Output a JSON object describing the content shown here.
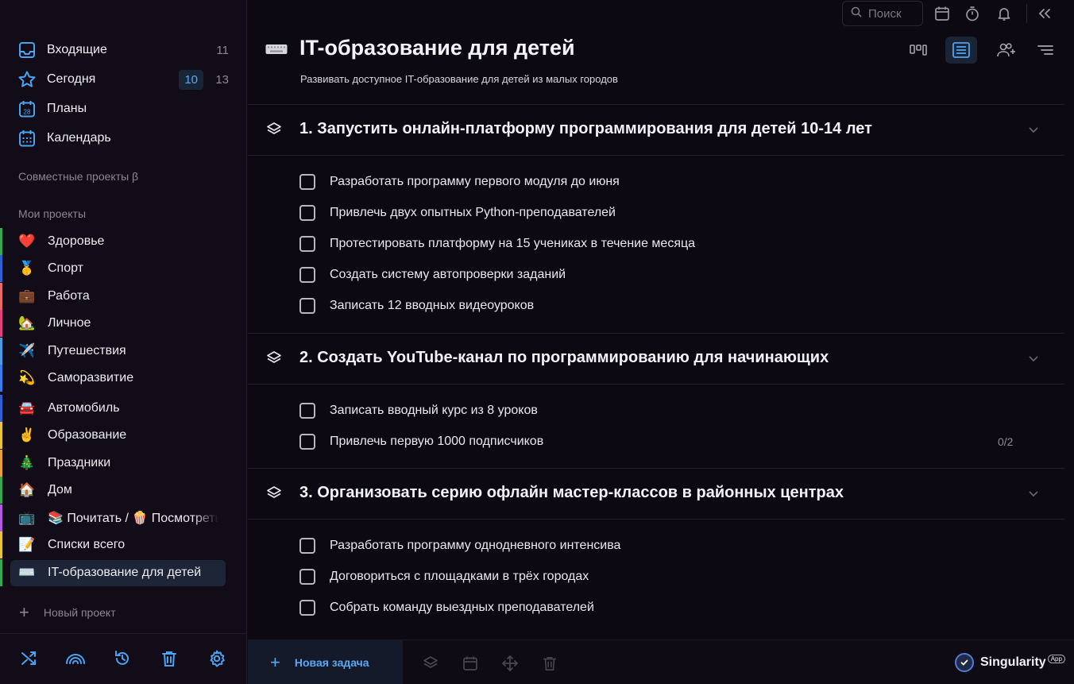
{
  "sidebar": {
    "nav": [
      {
        "label": "Входящие",
        "count": "11",
        "icon": "inbox-icon"
      },
      {
        "label": "Сегодня",
        "count_highlight": "10",
        "count": "13",
        "icon": "star-icon"
      },
      {
        "label": "Планы",
        "icon": "calendar-28-icon",
        "icon_text": "28"
      },
      {
        "label": "Календарь",
        "icon": "calendar-grid-icon"
      }
    ],
    "shared_projects_label": "Совместные проекты β",
    "my_projects_label": "Мои проекты",
    "projects": [
      {
        "emoji": "❤️",
        "name": "Здоровье",
        "color": "#3aa655"
      },
      {
        "emoji": "🥇",
        "name": "Спорт",
        "color": "#2f5fd0"
      },
      {
        "emoji": "💼",
        "name": "Работа",
        "color": "#e26a6a"
      },
      {
        "emoji": "🏡",
        "name": "Личное",
        "color": "#e0437a"
      },
      {
        "emoji": "✈️",
        "name": "Путешествия",
        "color": "#4a9be0"
      },
      {
        "emoji": "💫",
        "name": "Саморазвитие",
        "color": "#3b7be8"
      },
      {
        "emoji": "🚘",
        "name": "Автомобиль",
        "color": "#2f5fd0"
      },
      {
        "emoji": "✌️",
        "name": "Образование",
        "color": "#e8c63a"
      },
      {
        "emoji": "🎄",
        "name": "Праздники",
        "color": "#e8a03a"
      },
      {
        "emoji": "🏠",
        "name": "Дом",
        "color": "#3aa655"
      },
      {
        "emoji": "📺",
        "name_parts": [
          "📚 Почитать / ",
          "🍿 Посмотреть"
        ],
        "name": "📚 Почитать / 🍿 Посмотреть",
        "color": "#b05be0"
      },
      {
        "emoji": "📝",
        "name": "Списки всего",
        "color": "#e8c63a"
      },
      {
        "emoji": "⌨️",
        "name": "IT-образование для детей",
        "color": "#3aa655",
        "active": true
      }
    ],
    "new_project_label": "Новый проект",
    "footer_icons": [
      "shuffle-icon",
      "rainbow-icon",
      "history-icon",
      "trash-icon",
      "settings-icon"
    ]
  },
  "topbar": {
    "search_placeholder": "Поиск",
    "icons": [
      "calendar-icon",
      "timer-icon",
      "bell-icon",
      "collapse-icon"
    ]
  },
  "project": {
    "icon": "keyboard-icon",
    "title": "IT-образование для детей",
    "subtitle": "Развивать доступное IT-образование для детей из малых городов",
    "view_icons": [
      "board-view-icon",
      "list-view-icon",
      "add-user-icon",
      "sort-icon"
    ]
  },
  "goals": [
    {
      "title": "1. Запустить онлайн-платформу программирования для детей 10-14 лет",
      "tasks": [
        {
          "label": "Разработать программу первого модуля до июня"
        },
        {
          "label": "Привлечь двух опытных Python-преподавателей"
        },
        {
          "label": "Протестировать платформу на 15 учениках в течение месяца"
        },
        {
          "label": "Создать систему автопроверки заданий"
        },
        {
          "label": "Записать 12 вводных видеоуроков"
        }
      ]
    },
    {
      "title": "2. Создать YouTube-канал по программированию для начинающих",
      "tasks": [
        {
          "label": "Записать вводный курс из 8 уроков"
        },
        {
          "label": "Привлечь первую 1000 подписчиков",
          "progress": "0/2"
        }
      ]
    },
    {
      "title": "3. Организовать серию офлайн мастер-классов в районных центрах",
      "tasks": [
        {
          "label": "Разработать программу однодневного интенсива"
        },
        {
          "label": "Договориться с площадками в трёх городах"
        },
        {
          "label": "Собрать команду выездных преподавателей"
        }
      ]
    }
  ],
  "bottombar": {
    "new_task_label": "Новая задача",
    "icons": [
      "layers-icon",
      "calendar-icon",
      "move-icon",
      "trash-icon"
    ],
    "brand": "Singularity",
    "brand_badge": "App"
  }
}
